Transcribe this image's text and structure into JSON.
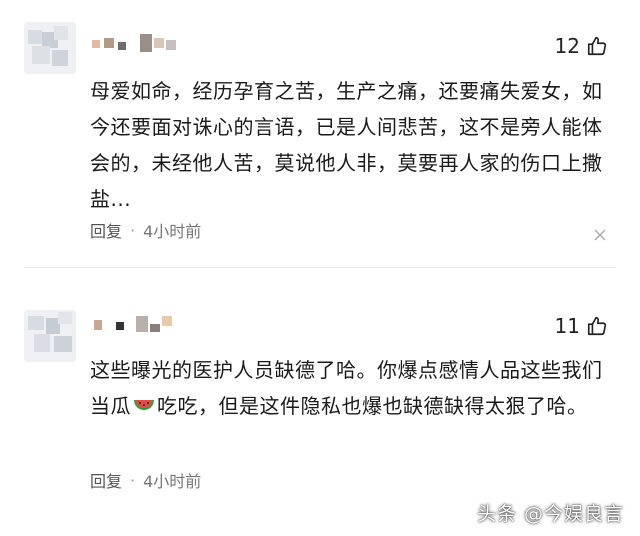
{
  "comments": [
    {
      "likes": "12",
      "text": "母爱如命，经历孕育之苦，生产之痛，还要痛失爱女，如今还要面对诛心的言语，已是人间悲苦，这不是旁人能体会的，未经他人苦，莫说他人非，莫要再人家的伤口上撒盐...",
      "reply_label": "回复",
      "separator": "·",
      "time": "4小时前"
    },
    {
      "likes": "11",
      "text_before_emoji": "这些曝光的医护人员缺德了哈。你爆点感情人品这些我们当瓜",
      "text_after_emoji": "吃吃，但是这件隐私也爆也缺德缺得太狠了哈。",
      "emoji_icon": "watermelon-icon",
      "reply_label": "回复",
      "separator": "·",
      "time": "4小时前"
    }
  ],
  "watermark": "头条 @今娱良言",
  "colors": {
    "background": "#ffffff",
    "text": "#1a1a1a",
    "meta": "#666666"
  }
}
